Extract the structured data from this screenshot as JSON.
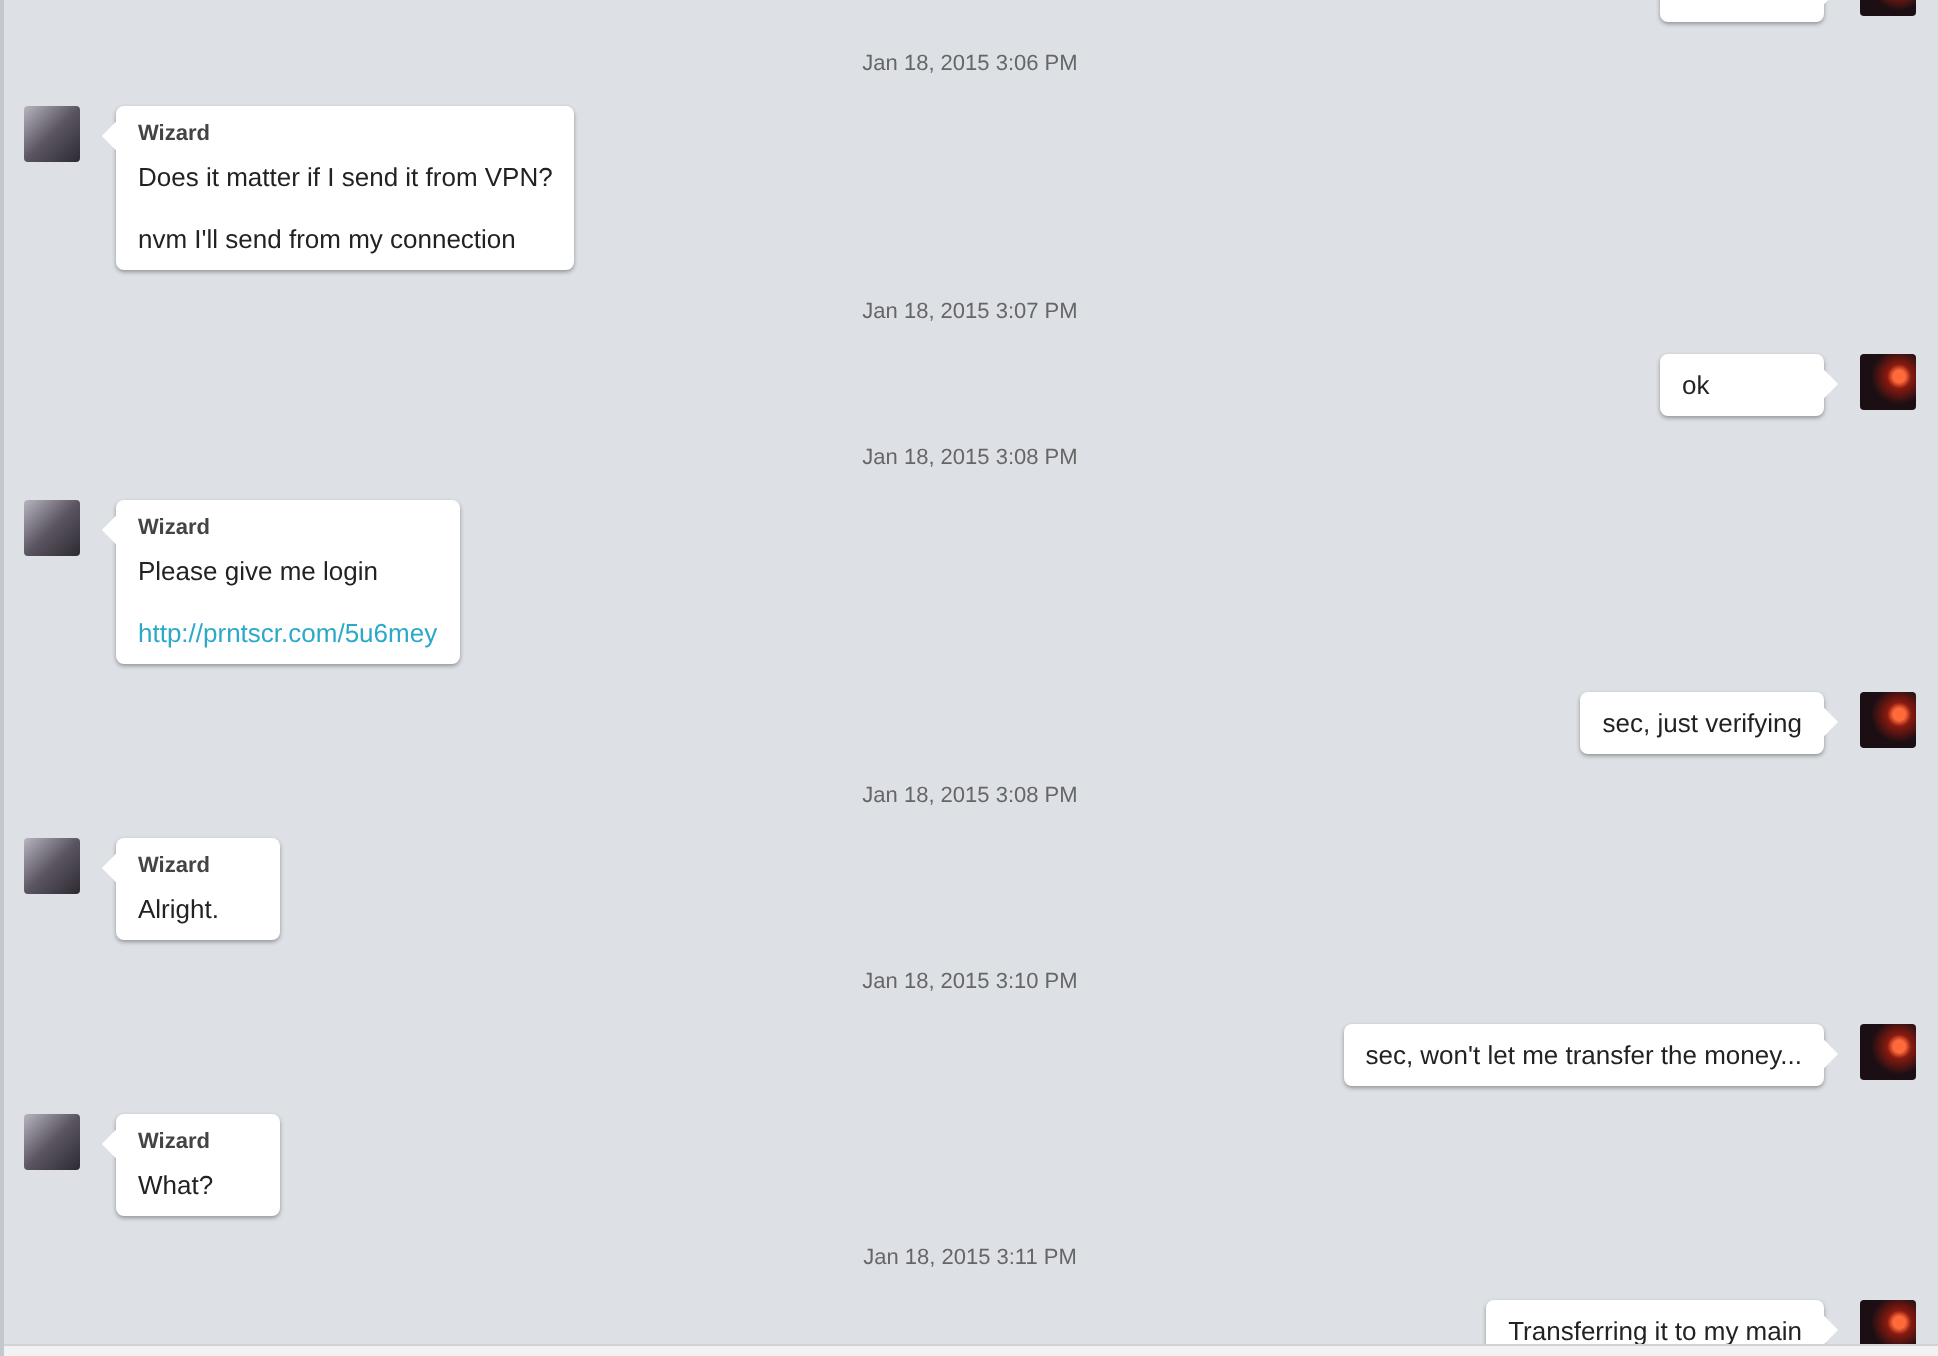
{
  "items": [
    {
      "kind": "message",
      "outgoing": true
    },
    {
      "kind": "timestamp",
      "text": "Jan 18, 2015 3:06 PM"
    },
    {
      "kind": "message",
      "outgoing": false,
      "sender": "Wizard",
      "lines": [
        {
          "kind": "text",
          "text": "Does it matter if I send it from VPN?"
        },
        {
          "kind": "text",
          "text": "nvm I'll send from my connection"
        }
      ]
    },
    {
      "kind": "timestamp",
      "text": "Jan 18, 2015 3:07 PM"
    },
    {
      "kind": "message",
      "outgoing": true,
      "lines": [
        {
          "kind": "text",
          "text": "ok"
        }
      ]
    },
    {
      "kind": "timestamp",
      "text": "Jan 18, 2015 3:08 PM"
    },
    {
      "kind": "message",
      "outgoing": false,
      "sender": "Wizard",
      "lines": [
        {
          "kind": "text",
          "text": "Please give me login"
        },
        {
          "kind": "link",
          "text": "http://prntscr.com/5u6mey"
        }
      ]
    },
    {
      "kind": "message",
      "outgoing": true,
      "lines": [
        {
          "kind": "text",
          "text": "sec, just verifying"
        }
      ]
    },
    {
      "kind": "timestamp",
      "text": "Jan 18, 2015 3:08 PM"
    },
    {
      "kind": "message",
      "outgoing": false,
      "sender": "Wizard",
      "lines": [
        {
          "kind": "text",
          "text": "Alright."
        }
      ]
    },
    {
      "kind": "timestamp",
      "text": "Jan 18, 2015 3:10 PM"
    },
    {
      "kind": "message",
      "outgoing": true,
      "lines": [
        {
          "kind": "text",
          "text": "sec, won't let me transfer the money..."
        }
      ]
    },
    {
      "kind": "message",
      "outgoing": false,
      "sender": "Wizard",
      "lines": [
        {
          "kind": "text",
          "text": "What?"
        }
      ]
    },
    {
      "kind": "timestamp",
      "text": "Jan 18, 2015 3:11 PM"
    },
    {
      "kind": "message",
      "outgoing": true,
      "lines": [
        {
          "kind": "text",
          "text": "Transferring it to my main"
        }
      ]
    }
  ]
}
